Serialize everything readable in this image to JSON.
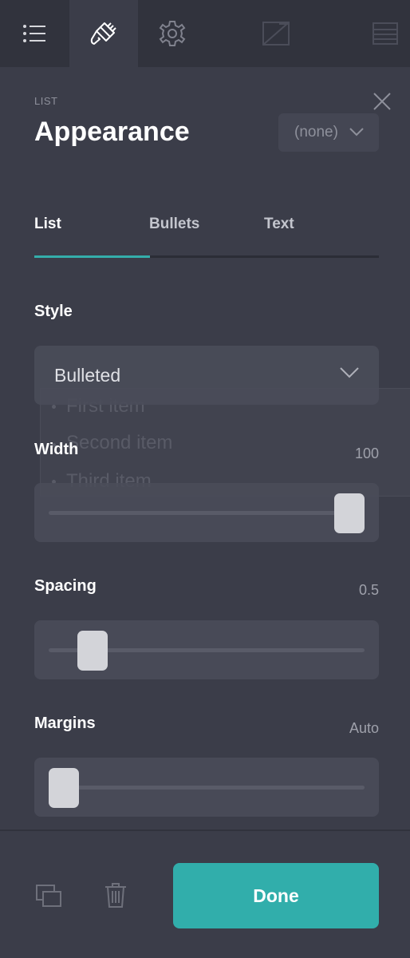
{
  "background_list": {
    "items": [
      "First item",
      "Second item",
      "Third item"
    ]
  },
  "toolbar": {
    "tools": [
      {
        "icon": "list-icon"
      },
      {
        "icon": "paintbrush-icon",
        "active": true
      },
      {
        "icon": "gear-icon"
      },
      {
        "icon": "image-icon"
      },
      {
        "icon": "table-icon"
      }
    ]
  },
  "header": {
    "section_label": "LIST",
    "title": "Appearance",
    "preset_value": "(none)"
  },
  "tabs": [
    {
      "label": "List",
      "active": true
    },
    {
      "label": "Bullets",
      "active": false
    },
    {
      "label": "Text",
      "active": false
    }
  ],
  "style": {
    "label": "Style",
    "value": "Bulleted"
  },
  "width": {
    "label": "Width",
    "value": "100",
    "level": 1.0
  },
  "spacing": {
    "label": "Spacing",
    "value": "0.5",
    "level": 0.1
  },
  "margins": {
    "label": "Margins",
    "value": "Auto",
    "level": 0.0
  },
  "footer": {
    "done_label": "Done",
    "duplicate_icon": "duplicate-icon",
    "delete_icon": "trash-icon"
  },
  "colors": {
    "accent": "#31aeab",
    "panel_bg": "#3b3d49",
    "toolbar_bg": "#31333d"
  }
}
